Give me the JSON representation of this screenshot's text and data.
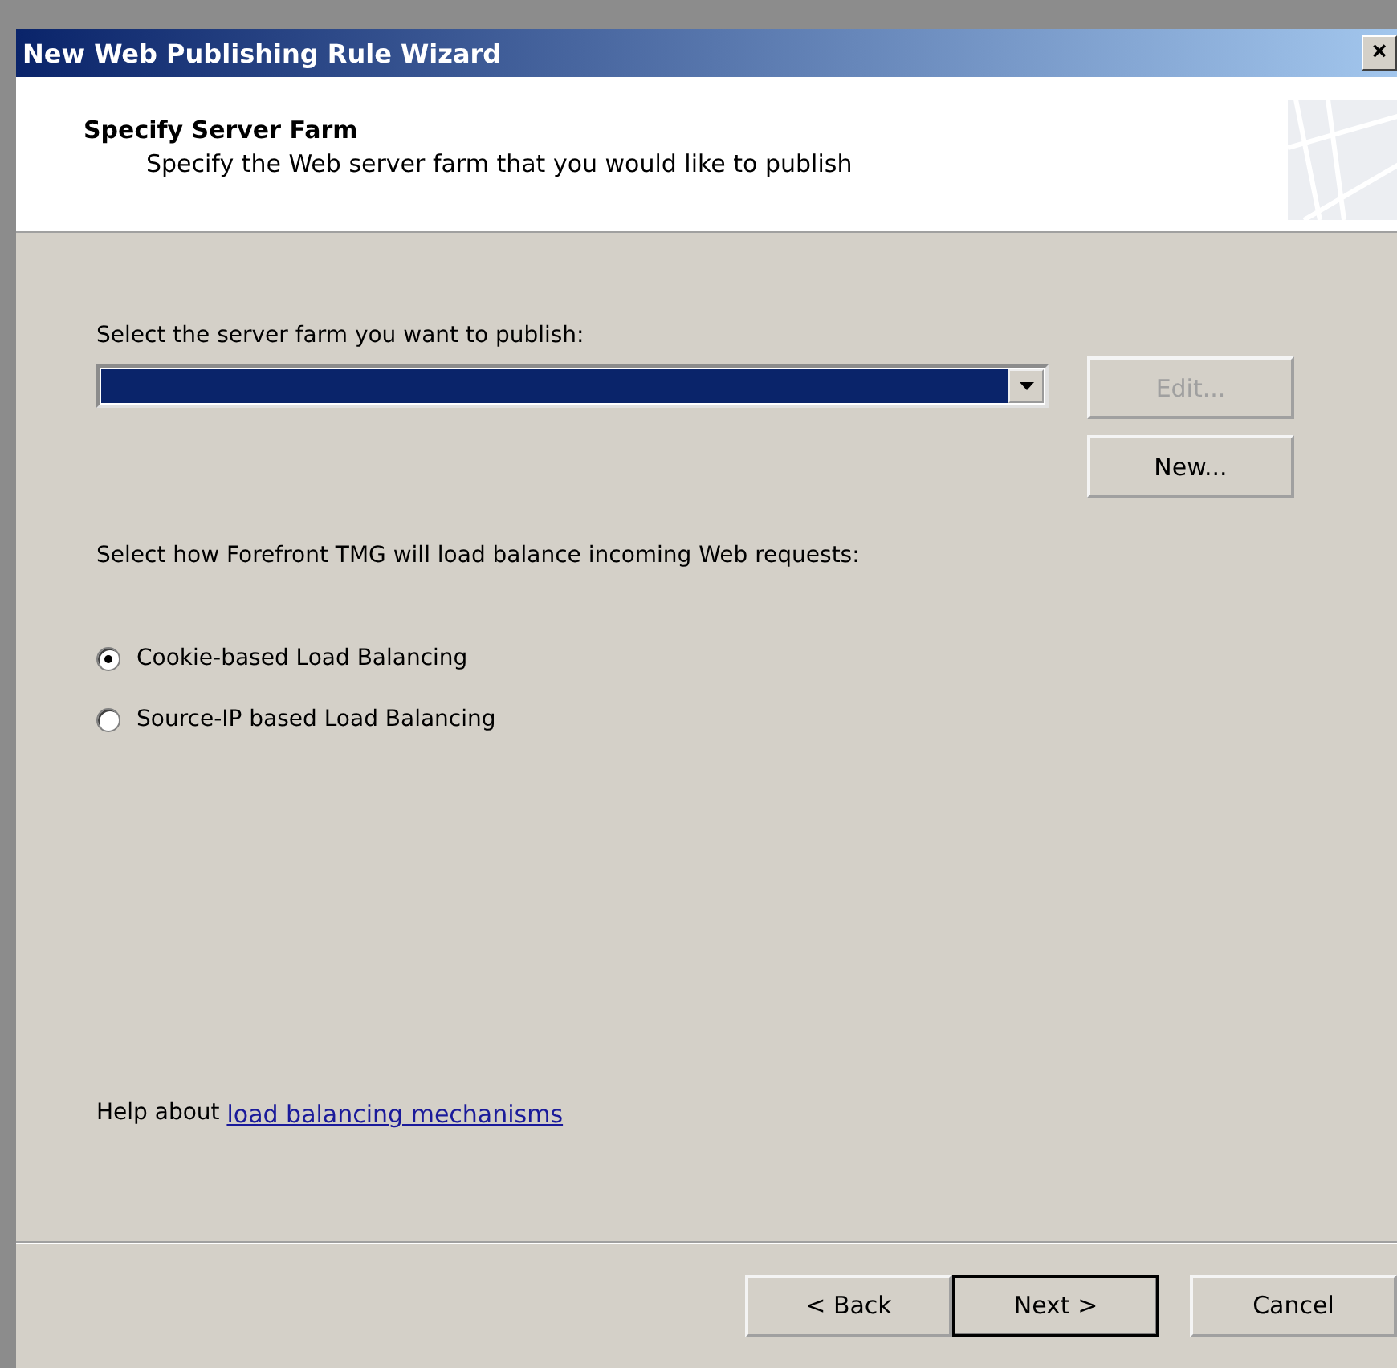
{
  "window": {
    "title": "New Web Publishing Rule Wizard",
    "close": "×"
  },
  "header": {
    "title": "Specify Server Farm",
    "subtitle": "Specify the Web server farm that you would like to publish"
  },
  "farm_label": "Select the server farm you want to publish:",
  "farm_dropdown": {
    "focused": true
  },
  "side_buttons": [
    {
      "label": "Edit...",
      "disabled": true
    },
    {
      "label": "New...",
      "disabled": false
    }
  ],
  "balance_label": "Select how Forefront TMG will load balance incoming Web requests:",
  "options": [
    {
      "label": "Cookie-based Load Balancing",
      "selected": true
    },
    {
      "label": "Source-IP based Load Balancing",
      "selected": false
    }
  ],
  "help": {
    "text": "Help about ",
    "link": "load balancing mechanisms"
  },
  "footer_buttons": [
    {
      "label": "< Back",
      "default": false
    },
    {
      "label": "Next >",
      "default": true
    },
    {
      "label": "Cancel",
      "default": false
    }
  ]
}
